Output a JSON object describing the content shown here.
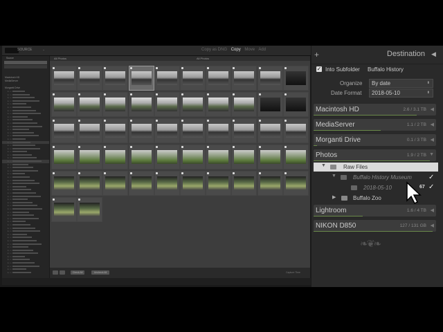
{
  "topbar": {
    "source": "SOURCE",
    "modes": [
      "Copy as DNG",
      "Copy",
      "Move",
      "Add"
    ],
    "active_mode": "Copy"
  },
  "left_panel": {
    "header": "Source",
    "devices": [
      "Macintosh HD",
      "MediaServer",
      "Morganti Drive"
    ]
  },
  "grid": {
    "header_left": "All Photos",
    "header_center": "All Photos",
    "footer_buttons": [
      "Check All",
      "Uncheck All"
    ],
    "sort_label": "Capture Time"
  },
  "destination": {
    "title": "Destination",
    "into_subfolder_label": "Into Subfolder",
    "into_subfolder_checked": true,
    "subfolder_name": "Buffalo History",
    "organize_label": "Organize",
    "organize_value": "By date",
    "date_format_label": "Date Format",
    "date_format_value": "2018-05-10",
    "volumes": [
      {
        "name": "Macintosh HD",
        "capacity": "2.6 / 3.1 TB",
        "fill": 0.84
      },
      {
        "name": "MediaServer",
        "capacity": "1.1 / 2 TB",
        "fill": 0.55
      },
      {
        "name": "Morganti Drive",
        "capacity": "0.1 / 3 TB",
        "fill": 0.03
      }
    ],
    "photos_volume": {
      "name": "Photos",
      "capacity": "1.9 / 2 TB",
      "fill": 0.95
    },
    "tree": {
      "raw_files": "Raw Files",
      "museum": "Buffalo History Museum",
      "date_folder": "2018-05-10",
      "date_count": "67",
      "zoo": "Buffalo Zoo"
    },
    "lower_volumes": [
      {
        "name": "Lightroom",
        "capacity": "1.6 / 4 TB",
        "fill": 0.4
      },
      {
        "name": "NIKON D850",
        "capacity": "127 / 131 GB",
        "fill": 0.97
      }
    ]
  },
  "colors": {
    "panel": "#2a2a2a",
    "volume": "#3c3c3c",
    "highlight": "#dadada",
    "grid_bg": "#3d3d3d"
  }
}
